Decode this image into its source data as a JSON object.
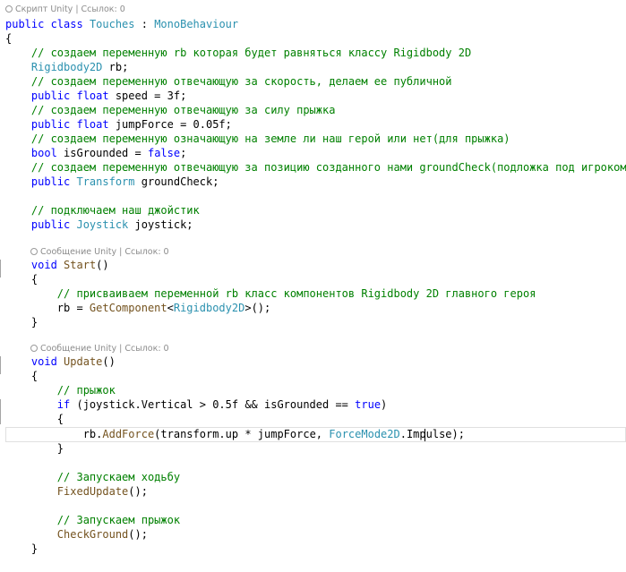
{
  "editor": {
    "codelens": {
      "script": "Скрипт Unity | Ссылок: 0",
      "start": "Сообщение Unity | Ссылок: 0",
      "update": "Сообщение Unity | Ссылок: 0"
    },
    "cursor_line": 30,
    "lines": [
      [
        {
          "t": "public ",
          "c": "kw"
        },
        {
          "t": "class ",
          "c": "kw"
        },
        {
          "t": "Touches",
          "c": "ty"
        },
        {
          "t": " : ",
          "c": "tk"
        },
        {
          "t": "MonoBehaviour",
          "c": "ty"
        }
      ],
      [
        {
          "t": "{",
          "c": "tk"
        }
      ],
      [
        {
          "t": "    // создаем переменную rb которая будет равняться классу Rigidbody 2D",
          "c": "cm"
        }
      ],
      [
        {
          "t": "    ",
          "c": "tk"
        },
        {
          "t": "Rigidbody2D",
          "c": "ty"
        },
        {
          "t": " rb;",
          "c": "tk"
        }
      ],
      [
        {
          "t": "    // создаем переменную отвечающую за скорость, делаем ее публичной",
          "c": "cm"
        }
      ],
      [
        {
          "t": "    ",
          "c": "tk"
        },
        {
          "t": "public ",
          "c": "kw"
        },
        {
          "t": "float",
          "c": "kw"
        },
        {
          "t": " speed = 3f;",
          "c": "tk"
        }
      ],
      [
        {
          "t": "    // создаем переменную отвечающую за силу прыжка",
          "c": "cm"
        }
      ],
      [
        {
          "t": "    ",
          "c": "tk"
        },
        {
          "t": "public ",
          "c": "kw"
        },
        {
          "t": "float",
          "c": "kw"
        },
        {
          "t": " jumpForce = 0.05f;",
          "c": "tk"
        }
      ],
      [
        {
          "t": "    // создаем переменную означающую на земле ли наш герой или нет(для прыжка)",
          "c": "cm"
        }
      ],
      [
        {
          "t": "    ",
          "c": "tk"
        },
        {
          "t": "bool",
          "c": "kw"
        },
        {
          "t": " isGrounded = ",
          "c": "tk"
        },
        {
          "t": "false",
          "c": "kw"
        },
        {
          "t": ";",
          "c": "tk"
        }
      ],
      [
        {
          "t": "    // создаем переменную отвечающую за позицию созданного нами groundCheck(подложка под игроком)",
          "c": "cm"
        }
      ],
      [
        {
          "t": "    ",
          "c": "tk"
        },
        {
          "t": "public ",
          "c": "kw"
        },
        {
          "t": "Transform",
          "c": "ty"
        },
        {
          "t": " groundCheck;",
          "c": "tk"
        }
      ],
      [],
      [
        {
          "t": "    // подключаем наш джойстик",
          "c": "cm"
        }
      ],
      [
        {
          "t": "    ",
          "c": "tk"
        },
        {
          "t": "public ",
          "c": "kw"
        },
        {
          "t": "Joystick",
          "c": "ty"
        },
        {
          "t": " joystick;",
          "c": "tk"
        }
      ],
      [],
      [
        {
          "t": "    ",
          "c": "tk"
        },
        {
          "t": "void",
          "c": "kw"
        },
        {
          "t": " ",
          "c": "tk"
        },
        {
          "t": "Start",
          "c": "fn"
        },
        {
          "t": "()",
          "c": "tk"
        }
      ],
      [
        {
          "t": "    {",
          "c": "tk"
        }
      ],
      [
        {
          "t": "        // присваиваем переменной rb класс компонентов Rigidbody 2D главного героя",
          "c": "cm"
        }
      ],
      [
        {
          "t": "        rb = ",
          "c": "tk"
        },
        {
          "t": "GetComponent",
          "c": "fn"
        },
        {
          "t": "<",
          "c": "tk"
        },
        {
          "t": "Rigidbody2D",
          "c": "ty"
        },
        {
          "t": ">();",
          "c": "tk"
        }
      ],
      [
        {
          "t": "    }",
          "c": "tk"
        }
      ],
      [],
      [
        {
          "t": "    ",
          "c": "tk"
        },
        {
          "t": "void",
          "c": "kw"
        },
        {
          "t": " ",
          "c": "tk"
        },
        {
          "t": "Update",
          "c": "fn"
        },
        {
          "t": "()",
          "c": "tk"
        }
      ],
      [
        {
          "t": "    {",
          "c": "tk"
        }
      ],
      [
        {
          "t": "        // прыжок",
          "c": "cm"
        }
      ],
      [
        {
          "t": "        ",
          "c": "tk"
        },
        {
          "t": "if",
          "c": "kw"
        },
        {
          "t": " (joystick.Vertical > 0.5f && isGrounded == ",
          "c": "tk"
        },
        {
          "t": "true",
          "c": "kw"
        },
        {
          "t": ")",
          "c": "tk"
        }
      ],
      [
        {
          "t": "        {",
          "c": "tk"
        }
      ],
      [
        {
          "t": "            rb.",
          "c": "tk"
        },
        {
          "t": "AddForce",
          "c": "fn"
        },
        {
          "t": "(transform.up * jumpForce, ",
          "c": "tk"
        },
        {
          "t": "ForceMode2D",
          "c": "ty"
        },
        {
          "t": ".Impulse);",
          "c": "tk"
        }
      ],
      [
        {
          "t": "        }",
          "c": "tk"
        }
      ],
      [],
      [
        {
          "t": "        // Запускаем ходьбу",
          "c": "cm"
        }
      ],
      [
        {
          "t": "        ",
          "c": "tk"
        },
        {
          "t": "FixedUpdate",
          "c": "fn"
        },
        {
          "t": "();",
          "c": "tk"
        }
      ],
      [],
      [
        {
          "t": "        // Запускаем прыжок",
          "c": "cm"
        }
      ],
      [
        {
          "t": "        ",
          "c": "tk"
        },
        {
          "t": "CheckGround",
          "c": "fn"
        },
        {
          "t": "();",
          "c": "tk"
        }
      ],
      [
        {
          "t": "    }",
          "c": "tk"
        }
      ]
    ]
  }
}
